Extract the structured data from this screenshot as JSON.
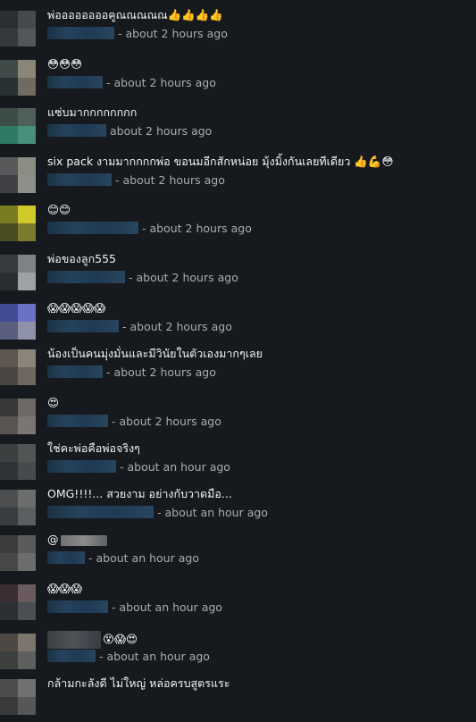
{
  "comments": [
    {
      "text": "พ่ออออออออคูณณณณณ👍👍👍👍",
      "time": "about 2 hours ago",
      "avatar": [
        "#2c3033",
        "#454a4c",
        "#34393b",
        "#52585a"
      ]
    },
    {
      "text": "😳😳😳",
      "time": "about 2 hours ago",
      "avatar": [
        "#3f4a49",
        "#8a8677",
        "#2a3133",
        "#6f6b61"
      ]
    },
    {
      "text": "แซ่บมากกกกกกกก",
      "time": "about 2 hours ago",
      "avatar": [
        "#3c4c46",
        "#4f5f5a",
        "#2f7a66",
        "#4a8f7c"
      ]
    },
    {
      "text": "six pack งามมากกกกพ่อ ขอนมอีกสักหน่อย มุ้งมิ้งกันเลยทีเดียว 👍💪😳",
      "time": "about 2 hours ago",
      "avatar": [
        "#58595a",
        "#8c8c83",
        "#3e4043",
        "#8e8f88"
      ]
    },
    {
      "text": "😊😊",
      "time": "about 2 hours ago",
      "avatar": [
        "#7b7c22",
        "#d0c92b",
        "#4a4c20",
        "#7d7a2e"
      ]
    },
    {
      "text": "พ่อของลูก555",
      "time": "about 2 hours ago",
      "avatar": [
        "#383c40",
        "#7e8185",
        "#2a2e33",
        "#9ea1a5"
      ]
    },
    {
      "text": "😱😱😱😱😱",
      "time": "about 2 hours ago",
      "avatar": [
        "#414b94",
        "#6b72c4",
        "#5a5f7d",
        "#8f91a8"
      ]
    },
    {
      "text": "น้องเป็นคนมุ่งมั่นและมีวินัยในตัวเองมากๆเลย",
      "time": "about 2 hours ago",
      "avatar": [
        "#5d5750",
        "#8b8478",
        "#4a4641",
        "#6d6760"
      ]
    },
    {
      "text": "😍",
      "time": "about 2 hours ago",
      "avatar": [
        "#3a3938",
        "#6d6a66",
        "#585552",
        "#7a7672"
      ]
    },
    {
      "text": "ใช่คะพ่อคือพ่อจริงๆ",
      "time": "about an hour ago",
      "avatar": [
        "#3c4040",
        "#505656",
        "#303436",
        "#454a4b"
      ]
    },
    {
      "text": "OMG!!!!... สวยงาม อย่างกับวาดมือ...",
      "time": "about an hour ago",
      "avatar": [
        "#4c4e4f",
        "#6c6e6e",
        "#3a3d3f",
        "#5c5e5f"
      ]
    },
    {
      "text": "@",
      "time": "about an hour ago",
      "avatar": [
        "#3a3c3d",
        "#5a5c5c",
        "#474949",
        "#6b6d6d"
      ]
    },
    {
      "text": "😱😱😱",
      "time": "about an hour ago",
      "avatar": [
        "#3a2e33",
        "#6a5a5e",
        "#2c2f33",
        "#4b4e52"
      ]
    },
    {
      "text": "😵😱😍",
      "time": "about an hour ago",
      "avatar": [
        "#4d4843",
        "#7b756e",
        "#3e403f",
        "#5e605f"
      ]
    },
    {
      "text": "กล้ามกะลังดี ไม่ใหญ่ หล่อครบสูตรแระ",
      "time": "",
      "avatar": [
        "#4a4c4d",
        "#6e7071",
        "#383a3b",
        "#555758"
      ]
    }
  ]
}
